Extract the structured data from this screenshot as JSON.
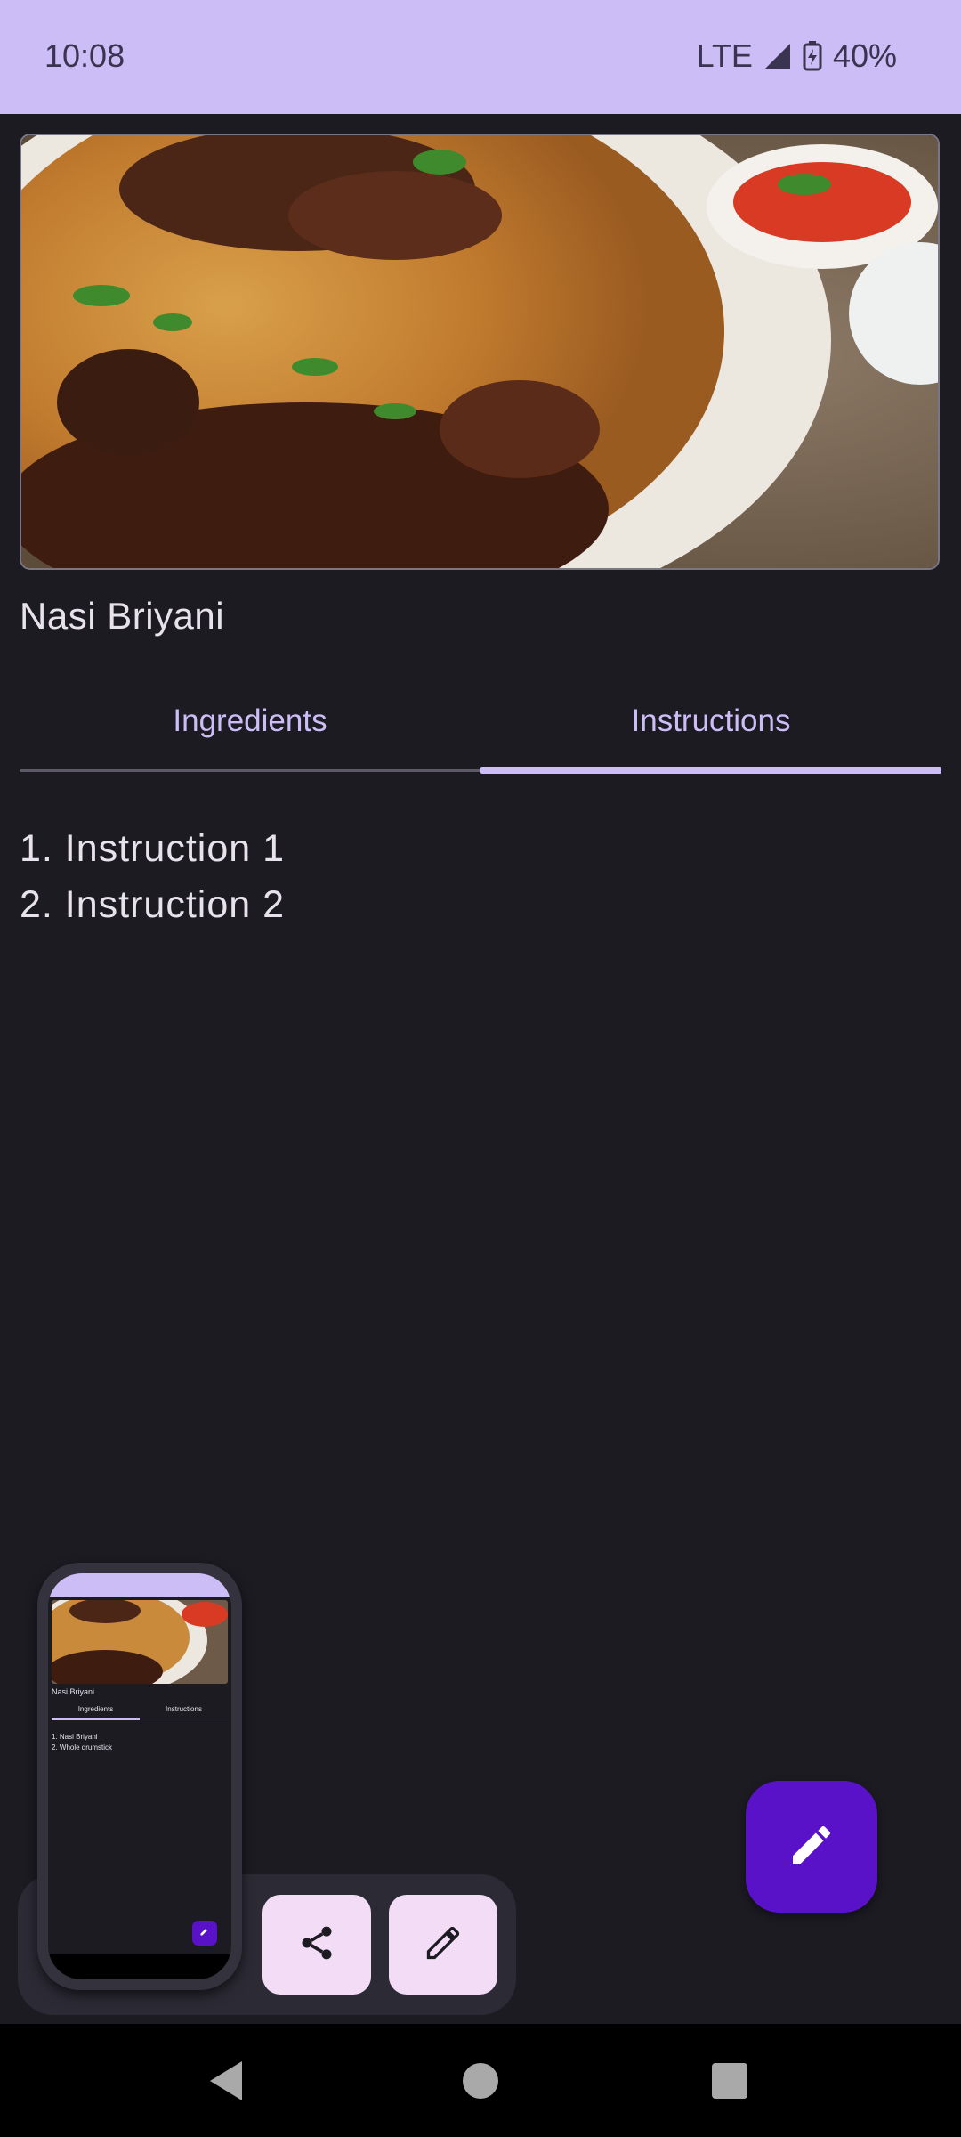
{
  "status_bar": {
    "time": "10:08",
    "network": "LTE",
    "battery": "40%"
  },
  "recipe": {
    "title": "Nasi Briyani",
    "image_description": "food-photo-briyani"
  },
  "tabs": [
    {
      "label": "Ingredients",
      "selected": false
    },
    {
      "label": "Instructions",
      "selected": true
    }
  ],
  "instructions": [
    "1. Instruction 1",
    "2. Instruction 2"
  ],
  "fab": {
    "icon": "pencil-icon"
  },
  "action_tray": {
    "buttons": [
      {
        "icon": "share-icon"
      },
      {
        "icon": "pencil-icon"
      }
    ]
  },
  "thumbnail_preview": {
    "title": "Nasi Briyani",
    "tabs": [
      "Ingredients",
      "Instructions"
    ],
    "list": [
      "1. Nasi Briyani",
      "2. Whole drumstick"
    ]
  },
  "colors": {
    "accent": "#cdbdf6",
    "background": "#1c1b22",
    "fab": "#5a12c8",
    "tray_button": "#f3dcf6"
  }
}
